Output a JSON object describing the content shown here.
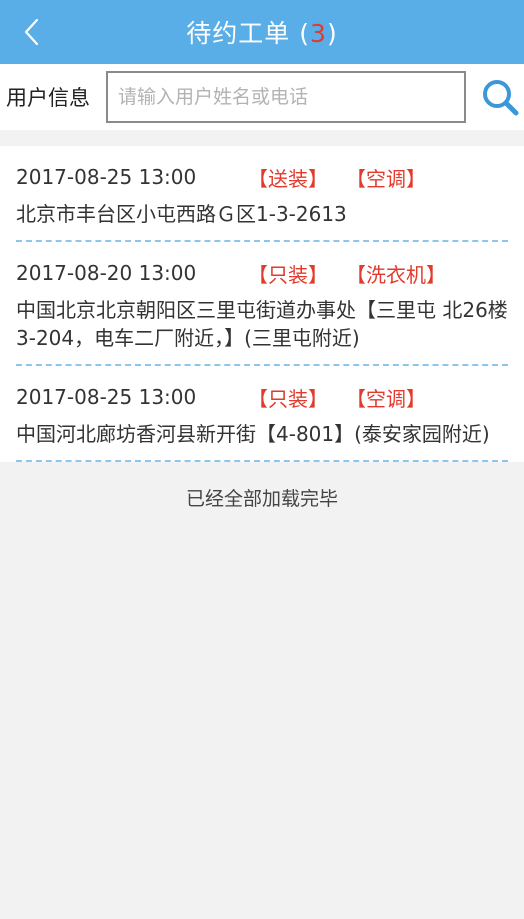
{
  "header": {
    "title": "待约工单",
    "count_open": "(",
    "count": "3",
    "count_close": ")"
  },
  "search": {
    "label": "用户信息",
    "placeholder": "请输入用户姓名或电话",
    "value": ""
  },
  "orders": [
    {
      "datetime": "2017-08-25 13:00",
      "service_tag": "【送装】",
      "product_tag": "【空调】",
      "address": "北京市丰台区小屯西路Ｇ区1-3-2613"
    },
    {
      "datetime": "2017-08-20 13:00",
      "service_tag": "【只装】",
      "product_tag": "【洗衣机】",
      "address": "中国北京北京朝阳区三里屯街道办事处【三里屯 北26楼3-204，电车二厂附近，】(三里屯附近)"
    },
    {
      "datetime": "2017-08-25 13:00",
      "service_tag": "【只装】",
      "product_tag": "【空调】",
      "address": "中国河北廊坊香河县新开街【4-801】(泰安家园附近)"
    }
  ],
  "footer": {
    "end_text": "已经全部加载完毕"
  },
  "colors": {
    "header_bg": "#5aaee8",
    "accent_red": "#e23a2c",
    "divider_blue": "#8cc6ec"
  }
}
